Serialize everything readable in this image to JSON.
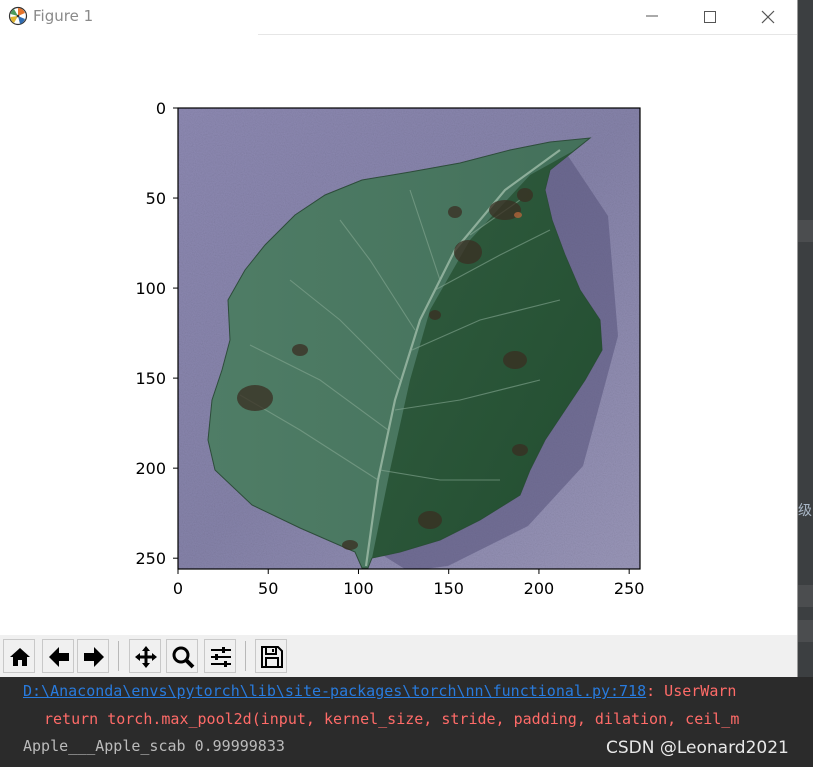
{
  "window": {
    "title": "Figure 1",
    "controls": {
      "minimize": "minimize",
      "maximize": "maximize",
      "close": "close"
    }
  },
  "plot": {
    "x_ticks": [
      "0",
      "50",
      "100",
      "150",
      "200",
      "250"
    ],
    "y_ticks": [
      "0",
      "50",
      "100",
      "150",
      "200",
      "250"
    ],
    "image_subject": "apple leaf with dark scab lesions on lavender background"
  },
  "toolbar": {
    "buttons": [
      "home-icon",
      "back-arrow-icon",
      "forward-arrow-icon",
      "pan-icon",
      "zoom-icon",
      "configure-subplots-icon",
      "save-icon"
    ]
  },
  "console": {
    "path_link": "D:\\Anaconda\\envs\\pytorch\\lib\\site-packages\\torch\\nn\\functional.py:718",
    "warning_suffix": ": UserWarn",
    "code_line": "return torch.max_pool2d(input, kernel_size, stride, padding, dilation, ceil_m",
    "result_line": "Apple___Apple_scab 0.99999833"
  },
  "watermark": "CSDN @Leonard2021",
  "ide_glyph": "级",
  "colors": {
    "console_bg": "#2b2b2b",
    "link": "#287bde",
    "error_text": "#ff6b68",
    "plain_text": "#bbbbbb",
    "leaf_green": "#3e6b4f",
    "background_lavender": "#8a87ad"
  }
}
